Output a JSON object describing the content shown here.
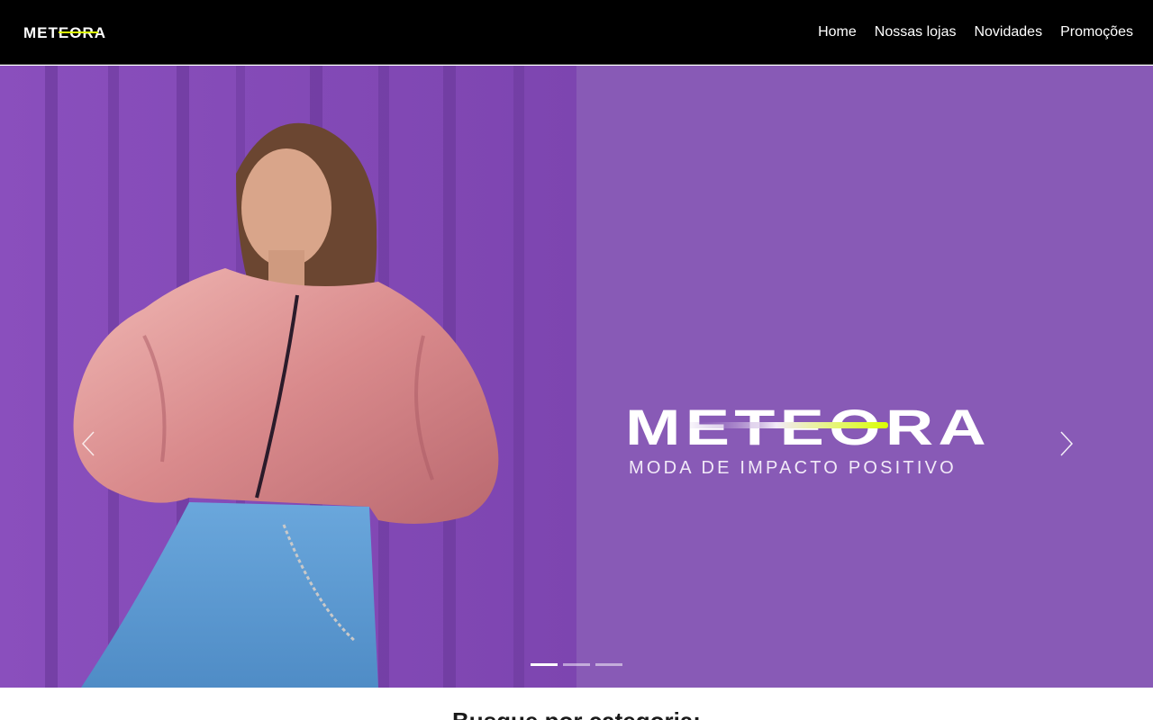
{
  "brand": {
    "name": "METEORA",
    "accent_color": "#daff01"
  },
  "nav": {
    "links": [
      {
        "label": "Home"
      },
      {
        "label": "Nossas lojas"
      },
      {
        "label": "Novidades"
      },
      {
        "label": "Promoções"
      }
    ]
  },
  "hero": {
    "logo_text": "METEORA",
    "tagline": "MODA DE IMPACTO POSITIVO",
    "panel_color": "#885ab6",
    "prev_icon": "chevron-left-icon",
    "next_icon": "chevron-right-icon",
    "slide_count": 3,
    "active_slide": 1
  },
  "categories": {
    "title": "Busque por categoria:"
  }
}
